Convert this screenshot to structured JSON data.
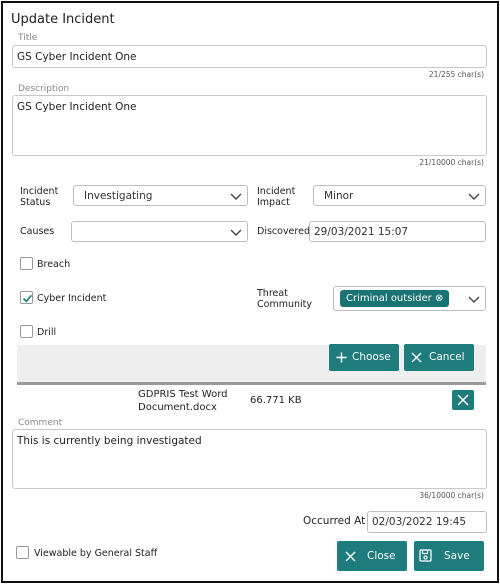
{
  "dialog": {
    "title": "Update Incident"
  },
  "title_field": {
    "label": "Title",
    "value": "GS Cyber Incident One",
    "count": "21/255 char(s)"
  },
  "description_field": {
    "label": "Description",
    "value": "GS Cyber Incident One",
    "count": "21/10000 char(s)"
  },
  "incident_status": {
    "label": "Incident Status",
    "value": "Investigating"
  },
  "incident_impact": {
    "label": "Incident Impact",
    "value": "Minor"
  },
  "causes": {
    "label": "Causes",
    "value": ""
  },
  "discovered": {
    "label": "Discovered",
    "value": "29/03/2021 15:07"
  },
  "breach": {
    "label": "Breach",
    "checked": false
  },
  "cyber_incident": {
    "label": "Cyber Incident",
    "checked": true
  },
  "threat_community": {
    "label": "Threat Community",
    "chip": "Criminal outsider"
  },
  "drill": {
    "label": "Drill",
    "checked": false
  },
  "attachments": {
    "choose_label": "Choose",
    "cancel_label": "Cancel",
    "file": {
      "name": "GDPRIS Test Word Document.docx",
      "size": "66.771 KB"
    }
  },
  "comment_field": {
    "label": "Comment",
    "value": "This is currently being investigated",
    "count": "36/10000 char(s)"
  },
  "occurred_at": {
    "label": "Occurred At",
    "value": "02/03/2022 19:45"
  },
  "viewable": {
    "label": "Viewable by General Staff",
    "checked": false
  },
  "footer": {
    "close_label": "Close",
    "save_label": "Save"
  },
  "colors": {
    "accent": "#1f7c7c",
    "chip": "#1a7373",
    "border": "#c8c8c8"
  }
}
